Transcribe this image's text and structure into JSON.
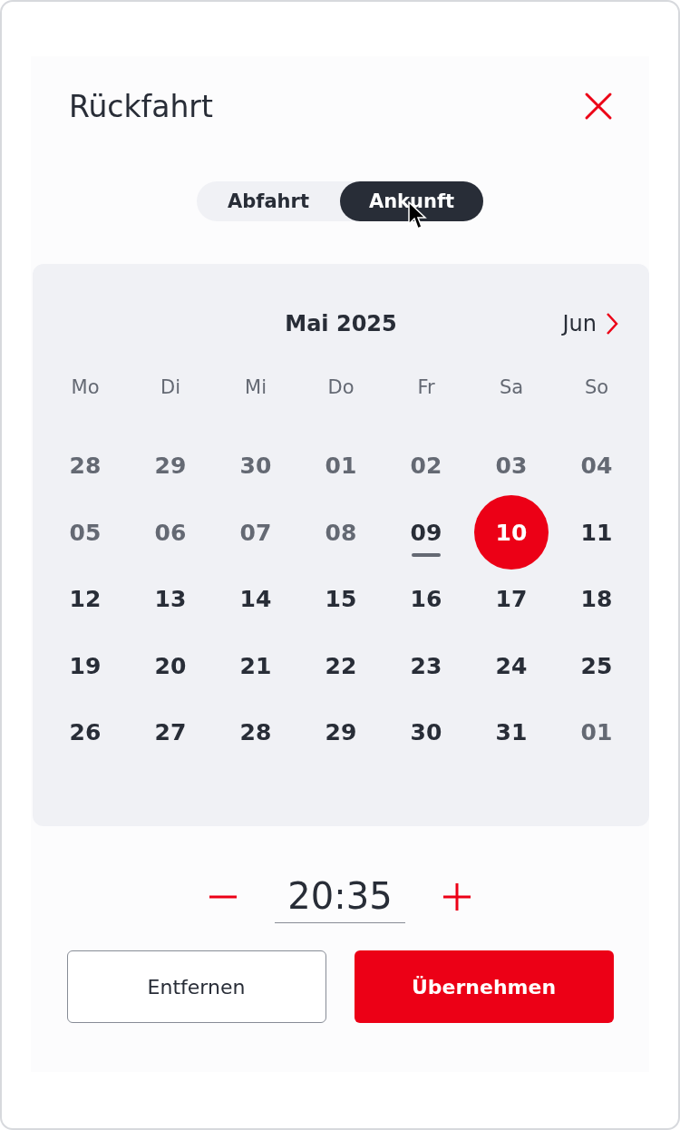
{
  "dialog": {
    "title": "Rückfahrt"
  },
  "mode_toggle": [
    {
      "label": "Abfahrt",
      "selected": false
    },
    {
      "label": "Ankunft",
      "selected": true
    }
  ],
  "calendar": {
    "month": "Mai 2025",
    "next_month": "Jun",
    "weekdays": [
      "Mo",
      "Di",
      "Mi",
      "Do",
      "Fr",
      "Sa",
      "So"
    ],
    "days": [
      {
        "label": "28",
        "muted": true,
        "today": false,
        "selected": false
      },
      {
        "label": "29",
        "muted": true,
        "today": false,
        "selected": false
      },
      {
        "label": "30",
        "muted": true,
        "today": false,
        "selected": false
      },
      {
        "label": "01",
        "muted": true,
        "today": false,
        "selected": false
      },
      {
        "label": "02",
        "muted": true,
        "today": false,
        "selected": false
      },
      {
        "label": "03",
        "muted": true,
        "today": false,
        "selected": false
      },
      {
        "label": "04",
        "muted": true,
        "today": false,
        "selected": false
      },
      {
        "label": "05",
        "muted": true,
        "today": false,
        "selected": false
      },
      {
        "label": "06",
        "muted": true,
        "today": false,
        "selected": false
      },
      {
        "label": "07",
        "muted": true,
        "today": false,
        "selected": false
      },
      {
        "label": "08",
        "muted": true,
        "today": false,
        "selected": false
      },
      {
        "label": "09",
        "muted": false,
        "today": true,
        "selected": false
      },
      {
        "label": "10",
        "muted": false,
        "today": false,
        "selected": true
      },
      {
        "label": "11",
        "muted": false,
        "today": false,
        "selected": false
      },
      {
        "label": "12",
        "muted": false,
        "today": false,
        "selected": false
      },
      {
        "label": "13",
        "muted": false,
        "today": false,
        "selected": false
      },
      {
        "label": "14",
        "muted": false,
        "today": false,
        "selected": false
      },
      {
        "label": "15",
        "muted": false,
        "today": false,
        "selected": false
      },
      {
        "label": "16",
        "muted": false,
        "today": false,
        "selected": false
      },
      {
        "label": "17",
        "muted": false,
        "today": false,
        "selected": false
      },
      {
        "label": "18",
        "muted": false,
        "today": false,
        "selected": false
      },
      {
        "label": "19",
        "muted": false,
        "today": false,
        "selected": false
      },
      {
        "label": "20",
        "muted": false,
        "today": false,
        "selected": false
      },
      {
        "label": "21",
        "muted": false,
        "today": false,
        "selected": false
      },
      {
        "label": "22",
        "muted": false,
        "today": false,
        "selected": false
      },
      {
        "label": "23",
        "muted": false,
        "today": false,
        "selected": false
      },
      {
        "label": "24",
        "muted": false,
        "today": false,
        "selected": false
      },
      {
        "label": "25",
        "muted": false,
        "today": false,
        "selected": false
      },
      {
        "label": "26",
        "muted": false,
        "today": false,
        "selected": false
      },
      {
        "label": "27",
        "muted": false,
        "today": false,
        "selected": false
      },
      {
        "label": "28",
        "muted": false,
        "today": false,
        "selected": false
      },
      {
        "label": "29",
        "muted": false,
        "today": false,
        "selected": false
      },
      {
        "label": "30",
        "muted": false,
        "today": false,
        "selected": false
      },
      {
        "label": "31",
        "muted": false,
        "today": false,
        "selected": false
      },
      {
        "label": "01",
        "muted": true,
        "today": false,
        "selected": false
      }
    ]
  },
  "time": {
    "value": "20:35"
  },
  "buttons": [
    {
      "label": "Entfernen",
      "kind": "secondary"
    },
    {
      "label": "Übernehmen",
      "kind": "primary"
    }
  ]
}
